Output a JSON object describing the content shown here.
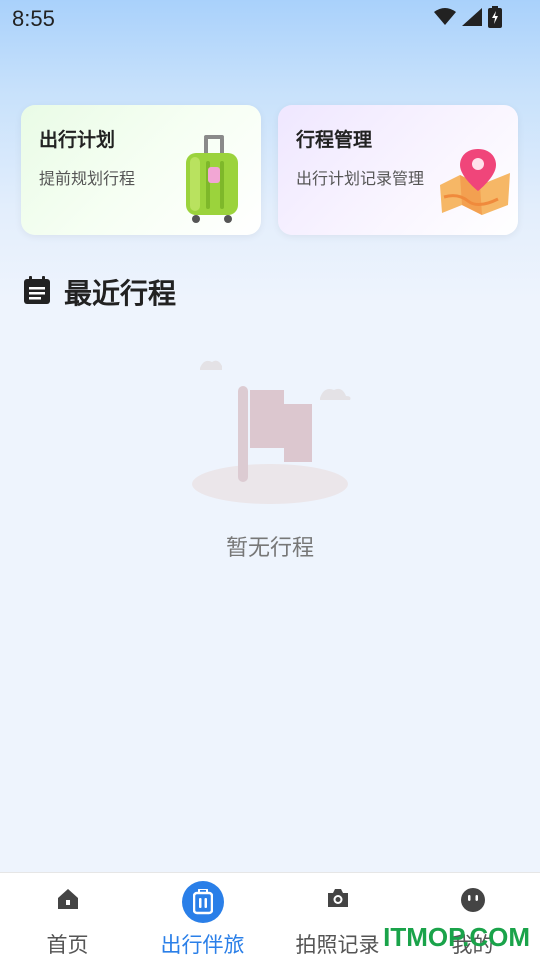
{
  "status": {
    "time": "8:55"
  },
  "cards": {
    "plan": {
      "title": "出行计划",
      "subtitle": "提前规划行程"
    },
    "manage": {
      "title": "行程管理",
      "subtitle": "出行计划记录管理"
    }
  },
  "section": {
    "title": "最近行程"
  },
  "empty": {
    "text": "暂无行程"
  },
  "tabs": [
    {
      "label": "首页",
      "icon": "home-icon"
    },
    {
      "label": "出行伴旅",
      "icon": "luggage-icon"
    },
    {
      "label": "拍照记录",
      "icon": "camera-icon"
    },
    {
      "label": "我的",
      "icon": "profile-icon"
    }
  ],
  "active_tab": "出行伴旅",
  "watermark": "ITMOP.COM",
  "colors": {
    "accent": "#2a7fe8",
    "watermark": "#1aa34a"
  }
}
